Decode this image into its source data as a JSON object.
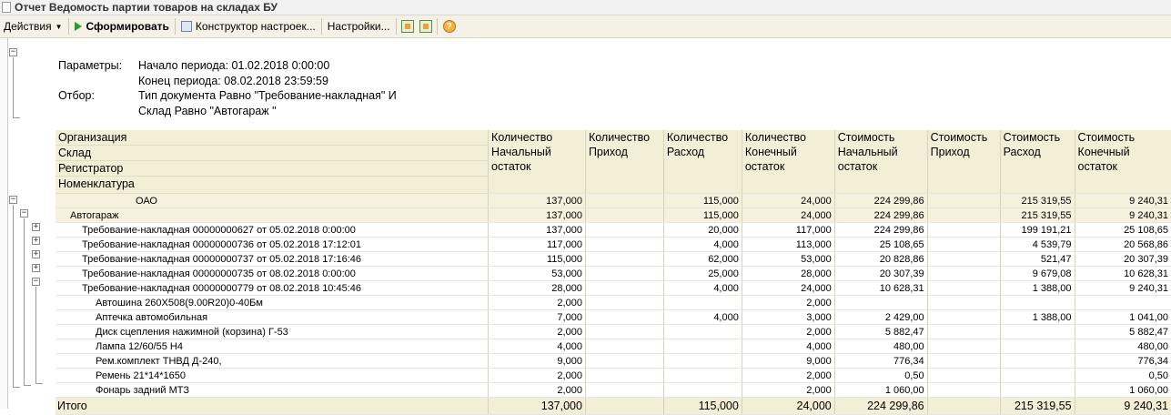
{
  "window": {
    "title": "Отчет  Ведомость партии товаров на складах БУ"
  },
  "toolbar": {
    "actions": "Действия",
    "generate": "Сформировать",
    "constructor": "Конструктор настроек...",
    "settings": "Настройки..."
  },
  "params": {
    "params_label": "Параметры:",
    "period_start": "Начало периода: 01.02.2018 0:00:00",
    "period_end": "Конец периода: 08.02.2018 23:59:59",
    "filter_label": "Отбор:",
    "filter_1": "Тип документа Равно \"Требование-накладная\" И",
    "filter_2": "Склад Равно \"Автогараж         \""
  },
  "columns": {
    "groupings": [
      "Организация",
      "Склад",
      "Регистратор",
      "Номенклатура"
    ],
    "qty_start": "Количество Начальный остаток",
    "qty_in": "Количество Приход",
    "qty_out": "Количество Расход",
    "qty_end": "Количество Конечный остаток",
    "cost_start": "Стоимость Начальный остаток",
    "cost_in": "Стоимость Приход",
    "cost_out": "Стоимость Расход",
    "cost_end": "Стоимость Конечный остаток"
  },
  "rows": [
    {
      "name": "ОАО",
      "qs": "137,000",
      "qi": "",
      "qo": "115,000",
      "qe": "24,000",
      "cs": "224 299,86",
      "ci": "",
      "co": "215 319,55",
      "ce": "9 240,31"
    },
    {
      "name": "Автогараж",
      "qs": "137,000",
      "qi": "",
      "qo": "115,000",
      "qe": "24,000",
      "cs": "224 299,86",
      "ci": "",
      "co": "215 319,55",
      "ce": "9 240,31"
    },
    {
      "name": "Требование-накладная 00000000627 от 05.02.2018 0:00:00",
      "qs": "137,000",
      "qi": "",
      "qo": "20,000",
      "qe": "117,000",
      "cs": "224 299,86",
      "ci": "",
      "co": "199 191,21",
      "ce": "25 108,65"
    },
    {
      "name": "Требование-накладная 00000000736 от 05.02.2018 17:12:01",
      "qs": "117,000",
      "qi": "",
      "qo": "4,000",
      "qe": "113,000",
      "cs": "25 108,65",
      "ci": "",
      "co": "4 539,79",
      "ce": "20 568,86"
    },
    {
      "name": "Требование-накладная 00000000737 от 05.02.2018 17:16:46",
      "qs": "115,000",
      "qi": "",
      "qo": "62,000",
      "qe": "53,000",
      "cs": "20 828,86",
      "ci": "",
      "co": "521,47",
      "ce": "20 307,39"
    },
    {
      "name": "Требование-накладная 00000000735 от 08.02.2018 0:00:00",
      "qs": "53,000",
      "qi": "",
      "qo": "25,000",
      "qe": "28,000",
      "cs": "20 307,39",
      "ci": "",
      "co": "9 679,08",
      "ce": "10 628,31"
    },
    {
      "name": "Требование-накладная 00000000779 от 08.02.2018 10:45:46",
      "qs": "28,000",
      "qi": "",
      "qo": "4,000",
      "qe": "24,000",
      "cs": "10 628,31",
      "ci": "",
      "co": "1 388,00",
      "ce": "9 240,31"
    },
    {
      "name": "Автошина 260Х508(9.00R20)0-40Бм",
      "qs": "2,000",
      "qi": "",
      "qo": "",
      "qe": "2,000",
      "cs": "",
      "ci": "",
      "co": "",
      "ce": ""
    },
    {
      "name": "Аптечка автомобильная",
      "qs": "7,000",
      "qi": "",
      "qo": "4,000",
      "qe": "3,000",
      "cs": "2 429,00",
      "ci": "",
      "co": "1 388,00",
      "ce": "1 041,00"
    },
    {
      "name": "Диск сцепления нажимной (корзина) Г-53",
      "qs": "2,000",
      "qi": "",
      "qo": "",
      "qe": "2,000",
      "cs": "5 882,47",
      "ci": "",
      "co": "",
      "ce": "5 882,47"
    },
    {
      "name": "Лампа 12/60/55 Н4",
      "qs": "4,000",
      "qi": "",
      "qo": "",
      "qe": "4,000",
      "cs": "480,00",
      "ci": "",
      "co": "",
      "ce": "480,00"
    },
    {
      "name": "Рем.комплект ТНВД Д-240,",
      "qs": "9,000",
      "qi": "",
      "qo": "",
      "qe": "9,000",
      "cs": "776,34",
      "ci": "",
      "co": "",
      "ce": "776,34"
    },
    {
      "name": "Ремень  21*14*1650",
      "qs": "2,000",
      "qi": "",
      "qo": "",
      "qe": "2,000",
      "cs": "0,50",
      "ci": "",
      "co": "",
      "ce": "0,50"
    },
    {
      "name": "Фонарь задний МТЗ",
      "qs": "2,000",
      "qi": "",
      "qo": "",
      "qe": "2,000",
      "cs": "1 060,00",
      "ci": "",
      "co": "",
      "ce": "1 060,00"
    }
  ],
  "total": {
    "name": "Итого",
    "qs": "137,000",
    "qi": "",
    "qo": "115,000",
    "qe": "24,000",
    "cs": "224 299,86",
    "ci": "",
    "co": "215 319,55",
    "ce": "9 240,31"
  }
}
